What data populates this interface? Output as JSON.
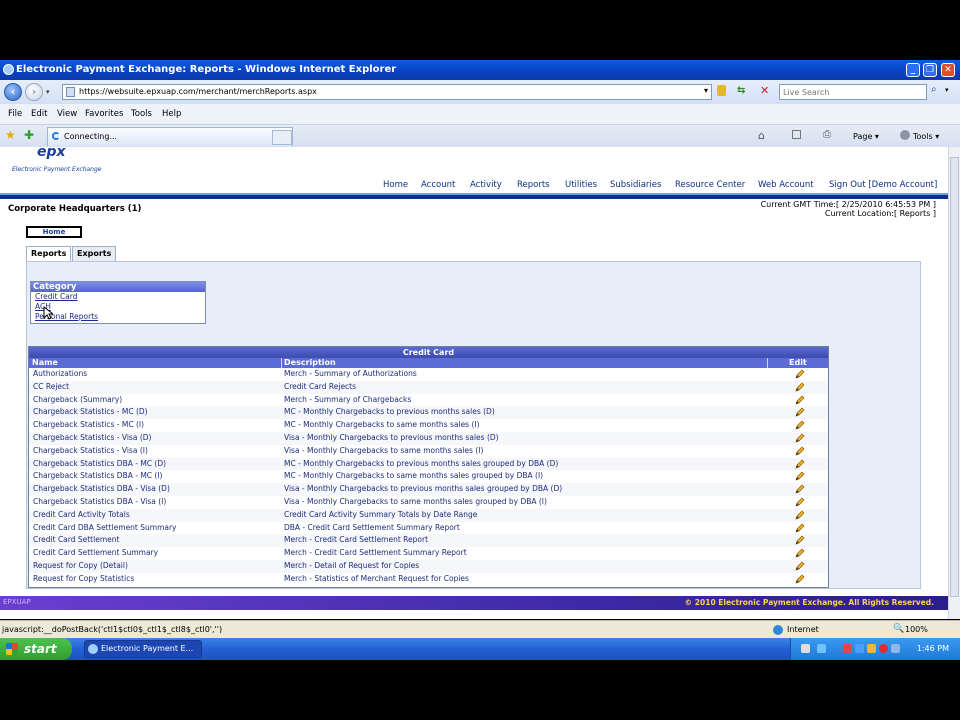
{
  "window": {
    "title": "Electronic Payment Exchange: Reports - Windows Internet Explorer",
    "minimize": "_",
    "restore": "❐",
    "close": "✕"
  },
  "addressbar": {
    "url": "https://websuite.epxuap.com/merchant/merchReports.aspx",
    "search_placeholder": "Live Search"
  },
  "menu": [
    "File",
    "Edit",
    "View",
    "Favorites",
    "Tools",
    "Help"
  ],
  "tab": {
    "label": "Connecting..."
  },
  "toolbar": {
    "page": "Page",
    "tools": "Tools"
  },
  "site": {
    "logo": "epx",
    "logo_sub": "Electronic Payment Exchange",
    "nav": [
      "Home",
      "Account",
      "Activity",
      "Reports",
      "Utilities",
      "Subsidiaries",
      "Resource Center",
      "Web Account",
      "Sign Out [Demo Account]"
    ],
    "corp": "Corporate Headquarters (1)",
    "gmt_line": "Current GMT Time:[ 2/25/2010 6:45:53 PM ]",
    "location_line": "Current Location:[ Reports ]",
    "home_button": "Home",
    "tabs": [
      "Reports",
      "Exports"
    ]
  },
  "category": {
    "header": "Category",
    "items": [
      "Credit Card",
      "ACH",
      "Personal Reports"
    ]
  },
  "grid": {
    "caption": "Credit Card",
    "columns": [
      "Name",
      "Description",
      "Edit"
    ],
    "rows": [
      {
        "name": "Authorizations",
        "desc": "Merch - Summary of Authorizations"
      },
      {
        "name": "CC Reject",
        "desc": "Credit Card Rejects"
      },
      {
        "name": "Chargeback (Summary)",
        "desc": "Merch - Summary of Chargebacks"
      },
      {
        "name": "Chargeback Statistics - MC (D)",
        "desc": "MC - Monthly Chargebacks to previous months sales (D)"
      },
      {
        "name": "Chargeback Statistics - MC (I)",
        "desc": "MC - Monthly Chargebacks to same months sales (I)"
      },
      {
        "name": "Chargeback Statistics - Visa (D)",
        "desc": "Visa - Monthly Chargebacks to previous months sales (D)"
      },
      {
        "name": "Chargeback Statistics - Visa (I)",
        "desc": "Visa - Monthly Chargebacks to same months sales (I)"
      },
      {
        "name": "Chargeback Statistics DBA - MC (D)",
        "desc": "MC - Monthly Chargebacks to previous months sales grouped by DBA (D)"
      },
      {
        "name": "Chargeback Statistics DBA - MC (I)",
        "desc": "MC - Monthly Chargebacks to same months sales grouped by DBA (I)"
      },
      {
        "name": "Chargeback Statistics DBA - Visa (D)",
        "desc": "Visa - Monthly Chargebacks to previous months sales grouped by DBA (D)"
      },
      {
        "name": "Chargeback Statistics DBA - Visa (I)",
        "desc": "Visa - Monthly Chargebacks to same months sales grouped by DBA (I)"
      },
      {
        "name": "Credit Card Activity Totals",
        "desc": "Credit Card Activity Summary Totals by Date Range"
      },
      {
        "name": "Credit Card DBA Settlement Summary",
        "desc": "DBA - Credit Card Settlement Summary Report"
      },
      {
        "name": "Credit Card Settlement",
        "desc": "Merch - Credit Card Settlement Report"
      },
      {
        "name": "Credit Card Settlement Summary",
        "desc": "Merch - Credit Card Settlement Summary Report"
      },
      {
        "name": "Request for Copy (Detail)",
        "desc": "Merch - Detail of Request for Copies"
      },
      {
        "name": "Request for Copy Statistics",
        "desc": "Merch - Statistics of Merchant Request for Copies"
      }
    ]
  },
  "footer": {
    "left": "EPXUAP",
    "right": "© 2010 Electronic Payment Exchange. All Rights Reserved."
  },
  "status": {
    "text": "javascript:__doPostBack('ctl1$ctl0$_ctl1$_ctl8$_ctl0','')",
    "zone": "Internet",
    "zoom": "100%"
  },
  "taskbar": {
    "start": "start",
    "item": "Electronic Payment E...",
    "clock": "1:46 PM"
  },
  "colors": {
    "titlebar": "#0b3fbf",
    "nav_border": "#0d2f85",
    "grid_header": "#5b6cd6",
    "footer_gradient": "#6a3fd0",
    "footer_text": "#ffd24a"
  }
}
